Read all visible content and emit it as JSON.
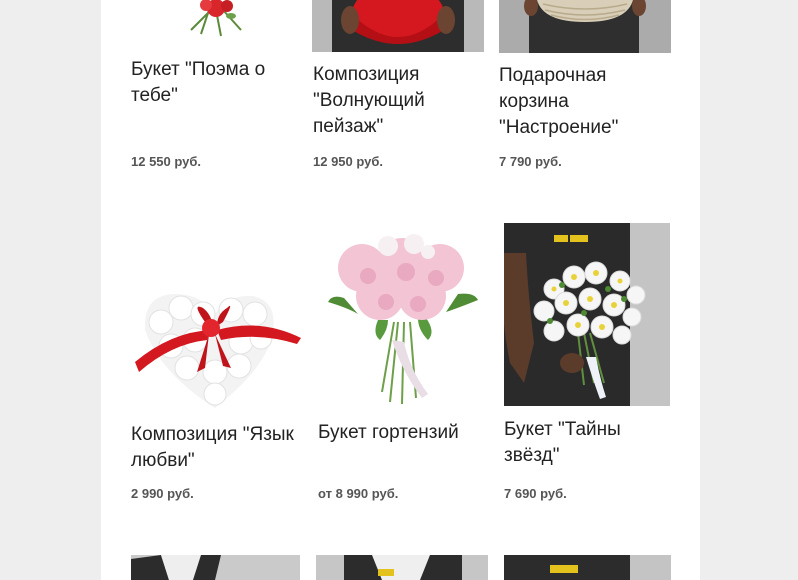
{
  "products": [
    {
      "title": "Букет \"Поэма о тебе\"",
      "price": "12 550 руб.",
      "image": "rose-bouquet-top"
    },
    {
      "title": "Композиция \"Волнующий пейзаж\"",
      "price": "12 950 руб.",
      "image": "red-hatbox"
    },
    {
      "title": "Подарочная корзина \"Настроение\"",
      "price": "7 790 руб.",
      "image": "wicker-basket"
    },
    {
      "title": "Композиция \"Язык любви\"",
      "price": "2 990 руб.",
      "image": "heart-chrysanthemum"
    },
    {
      "title": "Букет гортензий",
      "price": "от 8 990 руб.",
      "image": "pink-hydrangea-bouquet"
    },
    {
      "title": "Букет \"Тайны звёзд\"",
      "price": "7 690 руб.",
      "image": "white-aster-bouquet"
    }
  ],
  "colors": {
    "background": "#eeeeee",
    "panel": "#ffffff",
    "title": "#222222",
    "price": "#555555"
  }
}
